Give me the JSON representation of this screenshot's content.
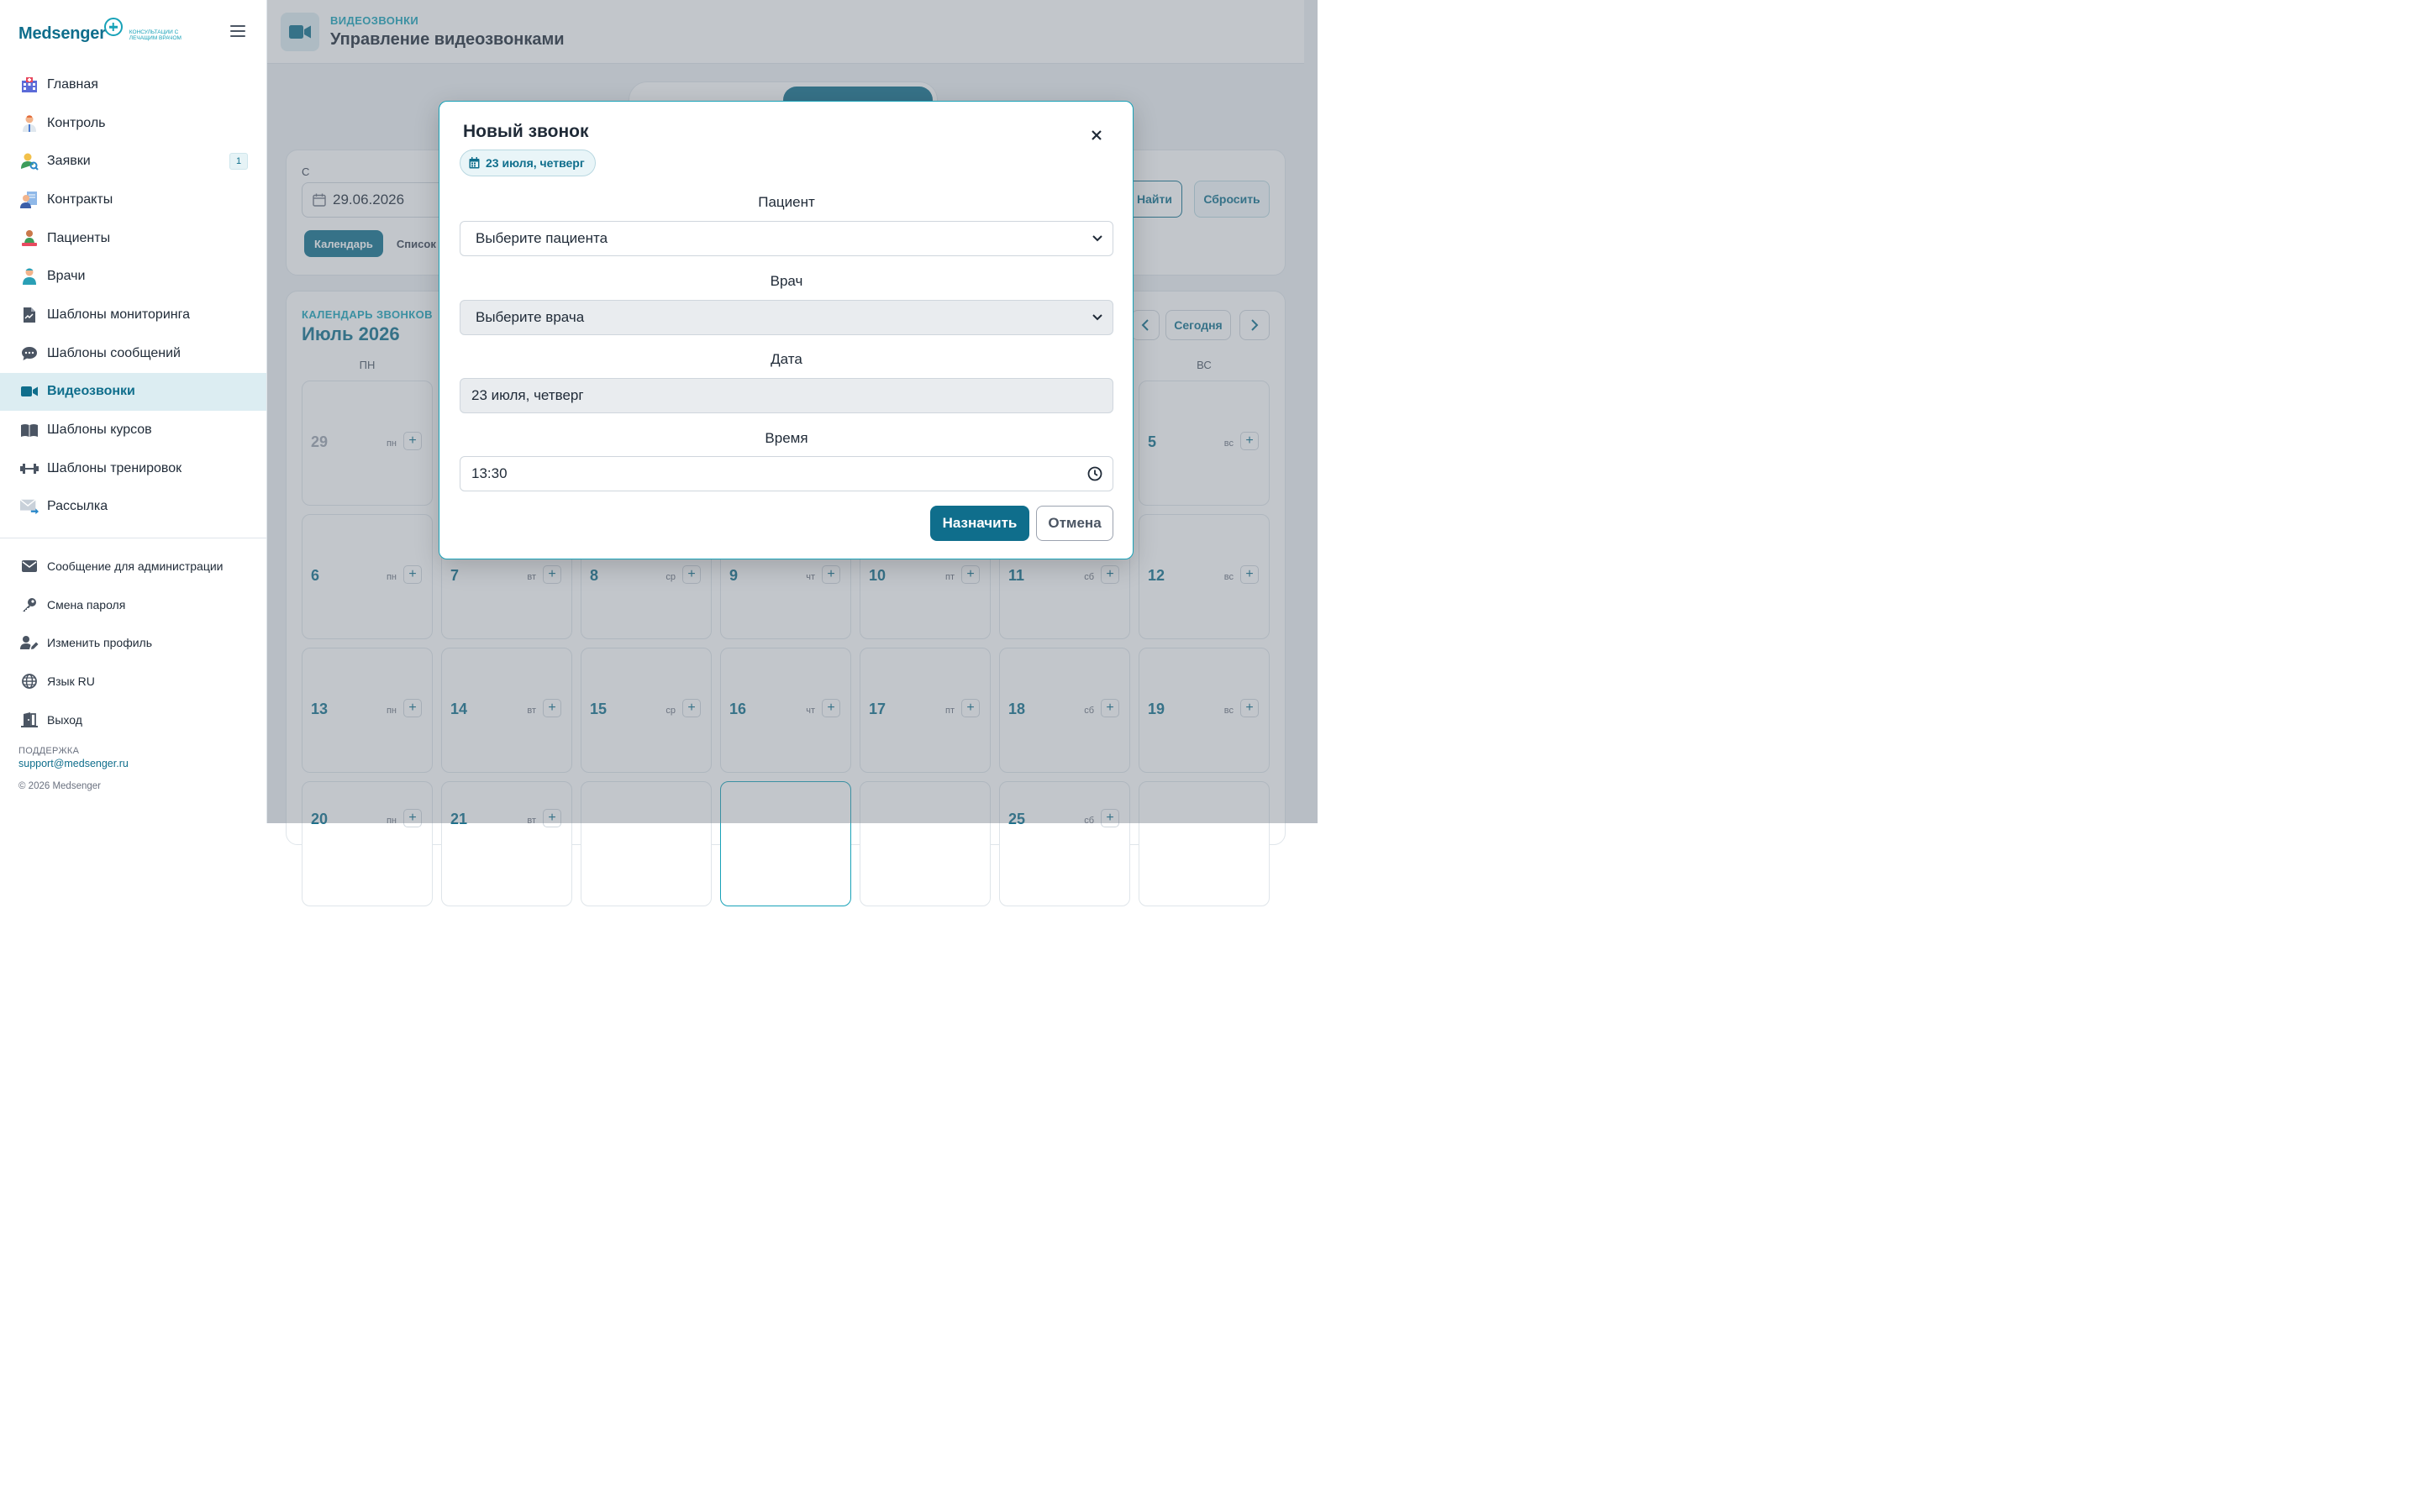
{
  "brand": {
    "name": "Medsenger",
    "tagline": "консультации с лечащим врачом",
    "accent": "#0f6e8c",
    "accent_light": "#18a2b8"
  },
  "sidebar": {
    "items": [
      {
        "label": "Главная",
        "icon": "hospital-icon"
      },
      {
        "label": "Контроль",
        "icon": "doctor-icon"
      },
      {
        "label": "Заявки",
        "icon": "person-search-icon",
        "badge": "1"
      },
      {
        "label": "Контракты",
        "icon": "contract-icon"
      },
      {
        "label": "Пациенты",
        "icon": "patient-icon"
      },
      {
        "label": "Врачи",
        "icon": "medic-icon"
      },
      {
        "label": "Шаблоны мониторинга",
        "icon": "file-chart-icon"
      },
      {
        "label": "Шаблоны сообщений",
        "icon": "chat-bubble-icon"
      },
      {
        "label": "Видеозвонки",
        "icon": "video-camera-icon",
        "active": true
      },
      {
        "label": "Шаблоны курсов",
        "icon": "book-icon"
      },
      {
        "label": "Шаблоны тренировок",
        "icon": "dumbbell-icon"
      },
      {
        "label": "Рассылка",
        "icon": "mail-send-icon"
      }
    ],
    "bottom_items": [
      {
        "label": "Сообщение для администрации",
        "icon": "envelope-icon"
      },
      {
        "label": "Смена пароля",
        "icon": "key-icon"
      },
      {
        "label": "Изменить профиль",
        "icon": "user-edit-icon"
      },
      {
        "label": "Язык RU",
        "icon": "globe-icon"
      },
      {
        "label": "Выход",
        "icon": "door-exit-icon"
      }
    ],
    "support_label": "ПОДДЕРЖКА",
    "support_email": "support@medsenger.ru",
    "copyright": "© 2026 Medsenger"
  },
  "header": {
    "kicker": "ВИДЕОЗВОНКИ",
    "title": "Управление видеозвонками"
  },
  "filters": {
    "from_label": "С",
    "from_value": "29.06.2026",
    "view_calendar": "Календарь",
    "view_list": "Список",
    "find": "Найти",
    "reset": "Сбросить"
  },
  "calendar": {
    "kicker": "КАЛЕНДАРЬ ЗВОНКОВ",
    "title": "Июль 2026",
    "today": "Сегодня",
    "dow_first": "ПН",
    "dow_last": "ВС"
  },
  "modal": {
    "title": "Новый звонок",
    "date_chip": "23 июля, четверг",
    "patient_label": "Пациент",
    "patient_placeholder": "Выберите пациента",
    "doctor_label": "Врач",
    "doctor_placeholder": "Выберите врача",
    "date_label": "Дата",
    "date_value": "23 июля, четверг",
    "time_label": "Время",
    "time_value": "13:30",
    "submit": "Назначить",
    "cancel": "Отмена"
  }
}
